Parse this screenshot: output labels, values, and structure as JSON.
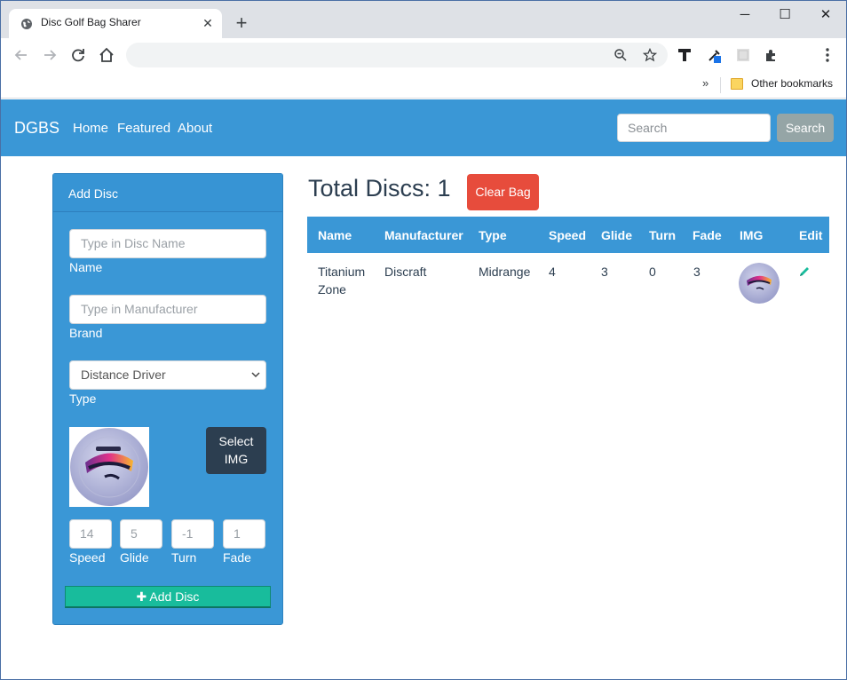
{
  "browser": {
    "tab_title": "Disc Golf Bag Sharer",
    "bookmarks_more": "»",
    "bookmark_folder": "Other bookmarks"
  },
  "nav": {
    "brand": "DGBS",
    "links": [
      "Home",
      "Featured",
      "About"
    ],
    "search_placeholder": "Search",
    "search_button": "Search"
  },
  "add_disc": {
    "title": "Add Disc",
    "name_placeholder": "Type in Disc Name",
    "name_label": "Name",
    "manufacturer_placeholder": "Type in Manufacturer",
    "brand_label": "Brand",
    "type_selected": "Distance Driver",
    "type_label": "Type",
    "select_img_button": "Select IMG",
    "speed_placeholder": "14",
    "glide_placeholder": "5",
    "turn_placeholder": "-1",
    "fade_placeholder": "1",
    "speed_label": "Speed",
    "glide_label": "Glide",
    "turn_label": "Turn",
    "fade_label": "Fade",
    "add_button": "Add Disc"
  },
  "summary": {
    "total_label": "Total Discs: 1",
    "clear_button": "Clear Bag"
  },
  "table": {
    "headers": [
      "Name",
      "Manufacturer",
      "Type",
      "Speed",
      "Glide",
      "Turn",
      "Fade",
      "IMG",
      "Edit"
    ],
    "rows": [
      {
        "name": "Titanium Zone",
        "manufacturer": "Discraft",
        "type": "Midrange",
        "speed": "4",
        "glide": "3",
        "turn": "0",
        "fade": "3"
      }
    ]
  },
  "colors": {
    "primary": "#3a97d6",
    "success": "#18bc9c",
    "danger": "#e74c3c",
    "dark": "#2c3e50",
    "secondary": "#95a5a6"
  },
  "icons": [
    "globe-icon",
    "close-icon",
    "plus-icon",
    "back-icon",
    "forward-icon",
    "reload-icon",
    "home-icon",
    "zoom-icon",
    "star-icon",
    "extension-icon",
    "menu-icon",
    "folder-icon",
    "edit-icon"
  ]
}
